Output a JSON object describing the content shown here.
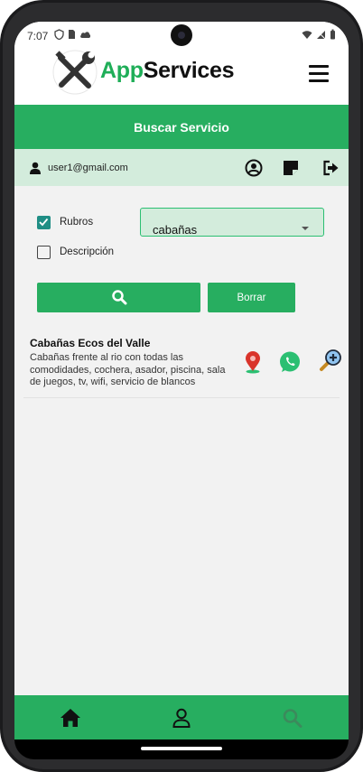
{
  "status_bar": {
    "time": "7:07"
  },
  "header": {
    "title_part1": "App",
    "title_part2": "Services",
    "logo_icon": "wrench-screwdriver-logo",
    "menu_icon": "hamburger-menu-icon"
  },
  "banner": {
    "title": "Buscar Servicio"
  },
  "user_bar": {
    "email": "user1@gmail.com",
    "icons": [
      "account-circle-icon",
      "note-icon",
      "logout-icon"
    ]
  },
  "filters": {
    "rubros": {
      "label": "Rubros",
      "checked": true
    },
    "descripcion": {
      "label": "Descripción",
      "checked": false
    },
    "select": {
      "value": "cabañas"
    }
  },
  "actions": {
    "search_icon": "search-icon",
    "clear_label": "Borrar"
  },
  "results": [
    {
      "title": "Cabañas Ecos del Valle",
      "description": "Cabañas frente al rio con todas las comodidades, cochera, asador, piscina, sala de juegos, tv, wifi, servicio de blancos",
      "icons": [
        "map-pin-icon",
        "whatsapp-icon",
        "zoom-in-icon"
      ]
    }
  ],
  "bottom_nav": {
    "items": [
      "home-icon",
      "user-icon",
      "search-icon"
    ],
    "active": "search-icon"
  },
  "colors": {
    "primary": "#27ae60",
    "light_green": "#d3ecdc",
    "checkbox": "#1f8e85",
    "background": "#f2f2f2"
  }
}
